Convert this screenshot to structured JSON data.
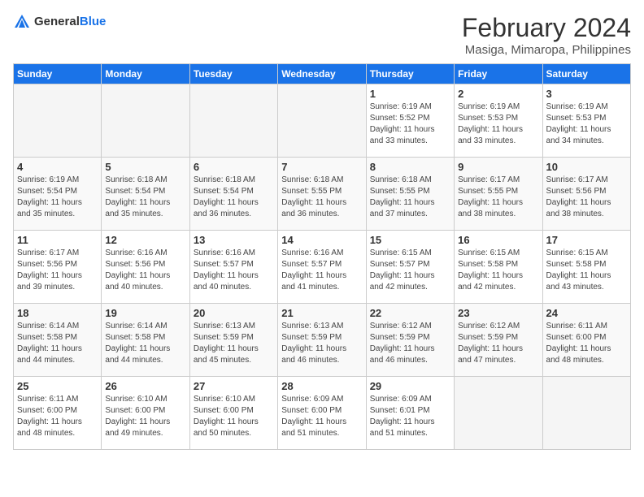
{
  "header": {
    "logo_general": "General",
    "logo_blue": "Blue",
    "main_title": "February 2024",
    "subtitle": "Masiga, Mimaropa, Philippines"
  },
  "weekdays": [
    "Sunday",
    "Monday",
    "Tuesday",
    "Wednesday",
    "Thursday",
    "Friday",
    "Saturday"
  ],
  "weeks": [
    [
      {
        "day": "",
        "info": ""
      },
      {
        "day": "",
        "info": ""
      },
      {
        "day": "",
        "info": ""
      },
      {
        "day": "",
        "info": ""
      },
      {
        "day": "1",
        "info": "Sunrise: 6:19 AM\nSunset: 5:52 PM\nDaylight: 11 hours\nand 33 minutes."
      },
      {
        "day": "2",
        "info": "Sunrise: 6:19 AM\nSunset: 5:53 PM\nDaylight: 11 hours\nand 33 minutes."
      },
      {
        "day": "3",
        "info": "Sunrise: 6:19 AM\nSunset: 5:53 PM\nDaylight: 11 hours\nand 34 minutes."
      }
    ],
    [
      {
        "day": "4",
        "info": "Sunrise: 6:19 AM\nSunset: 5:54 PM\nDaylight: 11 hours\nand 35 minutes."
      },
      {
        "day": "5",
        "info": "Sunrise: 6:18 AM\nSunset: 5:54 PM\nDaylight: 11 hours\nand 35 minutes."
      },
      {
        "day": "6",
        "info": "Sunrise: 6:18 AM\nSunset: 5:54 PM\nDaylight: 11 hours\nand 36 minutes."
      },
      {
        "day": "7",
        "info": "Sunrise: 6:18 AM\nSunset: 5:55 PM\nDaylight: 11 hours\nand 36 minutes."
      },
      {
        "day": "8",
        "info": "Sunrise: 6:18 AM\nSunset: 5:55 PM\nDaylight: 11 hours\nand 37 minutes."
      },
      {
        "day": "9",
        "info": "Sunrise: 6:17 AM\nSunset: 5:55 PM\nDaylight: 11 hours\nand 38 minutes."
      },
      {
        "day": "10",
        "info": "Sunrise: 6:17 AM\nSunset: 5:56 PM\nDaylight: 11 hours\nand 38 minutes."
      }
    ],
    [
      {
        "day": "11",
        "info": "Sunrise: 6:17 AM\nSunset: 5:56 PM\nDaylight: 11 hours\nand 39 minutes."
      },
      {
        "day": "12",
        "info": "Sunrise: 6:16 AM\nSunset: 5:56 PM\nDaylight: 11 hours\nand 40 minutes."
      },
      {
        "day": "13",
        "info": "Sunrise: 6:16 AM\nSunset: 5:57 PM\nDaylight: 11 hours\nand 40 minutes."
      },
      {
        "day": "14",
        "info": "Sunrise: 6:16 AM\nSunset: 5:57 PM\nDaylight: 11 hours\nand 41 minutes."
      },
      {
        "day": "15",
        "info": "Sunrise: 6:15 AM\nSunset: 5:57 PM\nDaylight: 11 hours\nand 42 minutes."
      },
      {
        "day": "16",
        "info": "Sunrise: 6:15 AM\nSunset: 5:58 PM\nDaylight: 11 hours\nand 42 minutes."
      },
      {
        "day": "17",
        "info": "Sunrise: 6:15 AM\nSunset: 5:58 PM\nDaylight: 11 hours\nand 43 minutes."
      }
    ],
    [
      {
        "day": "18",
        "info": "Sunrise: 6:14 AM\nSunset: 5:58 PM\nDaylight: 11 hours\nand 44 minutes."
      },
      {
        "day": "19",
        "info": "Sunrise: 6:14 AM\nSunset: 5:58 PM\nDaylight: 11 hours\nand 44 minutes."
      },
      {
        "day": "20",
        "info": "Sunrise: 6:13 AM\nSunset: 5:59 PM\nDaylight: 11 hours\nand 45 minutes."
      },
      {
        "day": "21",
        "info": "Sunrise: 6:13 AM\nSunset: 5:59 PM\nDaylight: 11 hours\nand 46 minutes."
      },
      {
        "day": "22",
        "info": "Sunrise: 6:12 AM\nSunset: 5:59 PM\nDaylight: 11 hours\nand 46 minutes."
      },
      {
        "day": "23",
        "info": "Sunrise: 6:12 AM\nSunset: 5:59 PM\nDaylight: 11 hours\nand 47 minutes."
      },
      {
        "day": "24",
        "info": "Sunrise: 6:11 AM\nSunset: 6:00 PM\nDaylight: 11 hours\nand 48 minutes."
      }
    ],
    [
      {
        "day": "25",
        "info": "Sunrise: 6:11 AM\nSunset: 6:00 PM\nDaylight: 11 hours\nand 48 minutes."
      },
      {
        "day": "26",
        "info": "Sunrise: 6:10 AM\nSunset: 6:00 PM\nDaylight: 11 hours\nand 49 minutes."
      },
      {
        "day": "27",
        "info": "Sunrise: 6:10 AM\nSunset: 6:00 PM\nDaylight: 11 hours\nand 50 minutes."
      },
      {
        "day": "28",
        "info": "Sunrise: 6:09 AM\nSunset: 6:00 PM\nDaylight: 11 hours\nand 51 minutes."
      },
      {
        "day": "29",
        "info": "Sunrise: 6:09 AM\nSunset: 6:01 PM\nDaylight: 11 hours\nand 51 minutes."
      },
      {
        "day": "",
        "info": ""
      },
      {
        "day": "",
        "info": ""
      }
    ]
  ]
}
